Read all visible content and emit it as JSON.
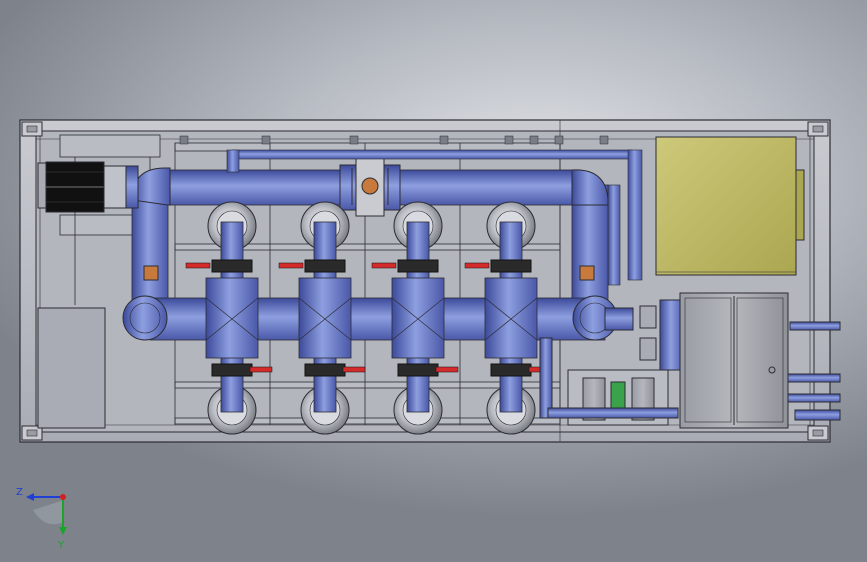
{
  "viewport": {
    "background_colors": [
      "#e3e5e9",
      "#b7bbc2",
      "#7d828b"
    ]
  },
  "model": {
    "pipe_color": "#6b7fc9",
    "pipe_dark": "#3c4a9a",
    "pipe_light": "#9aa9e6",
    "frame_color": "#b9bcc3",
    "frame_line": "#2c2c33",
    "panel_color": "#c4c06a",
    "valve_handle_color": "#d42a2a",
    "valve_body_color": "#2a2a2a",
    "gauge_color": "#c77a3c",
    "vessel_count": 4,
    "filter_housing_count": 8
  },
  "triad": {
    "z_label": "Z",
    "y_label": "Y",
    "z_color": "#1f3fd6",
    "y_color": "#1aa52a",
    "x_color": "#d42020"
  }
}
